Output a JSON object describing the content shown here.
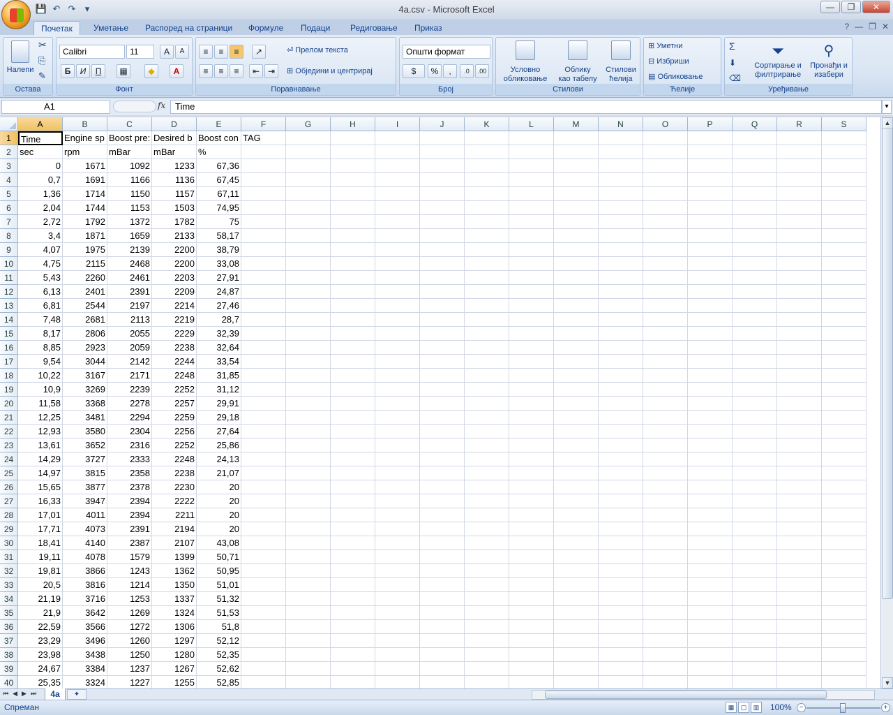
{
  "window": {
    "title": "4a.csv - Microsoft Excel"
  },
  "qat": {
    "save": "💾",
    "undo": "↶",
    "redo": "↷",
    "more": "▾"
  },
  "window_controls": {
    "minimize": "—",
    "restore": "❐",
    "close": "✕"
  },
  "tabs": [
    "Почетак",
    "Уметање",
    "Распоред на страници",
    "Формуле",
    "Подаци",
    "Редиговање",
    "Приказ"
  ],
  "ribbon": {
    "clipboard": {
      "label": "Остава",
      "paste": "Налепи"
    },
    "font": {
      "label": "Фонт",
      "font_name": "Calibri",
      "font_size": "11",
      "bold": "Б",
      "italic": "И",
      "underline": "П"
    },
    "alignment": {
      "label": "Поравнавање",
      "wrap": "Прелом текста",
      "merge": "Обједини и центрирај"
    },
    "number": {
      "label": "Број",
      "format": "Општи формат",
      "percent": "%",
      "comma": ","
    },
    "styles": {
      "label": "Стилови",
      "cond1": "Условно",
      "cond2": "обликовање",
      "table1": "Облику",
      "table2": "као табелу",
      "cell1": "Стилови",
      "cell2": "ћелија"
    },
    "cells": {
      "label": "Ћелије",
      "insert": "Уметни",
      "delete": "Избриши",
      "format": "Обликовање"
    },
    "editing": {
      "label": "Уређивање",
      "sort1": "Сортирање и",
      "sort2": "филтрирање",
      "find1": "Пронађи и",
      "find2": "изабери",
      "sigma": "Σ"
    }
  },
  "formula_bar": {
    "name_box": "A1",
    "fx": "fx",
    "content": "Time"
  },
  "columns": [
    "A",
    "B",
    "C",
    "D",
    "E",
    "F",
    "G",
    "H",
    "I",
    "J",
    "K",
    "L",
    "M",
    "N",
    "O",
    "P",
    "Q",
    "R",
    "S"
  ],
  "rows": [
    [
      "Time",
      "Engine sp",
      "Boost pre:",
      "Desired b",
      "Boost con",
      "TAG"
    ],
    [
      "sec",
      "rpm",
      "mBar",
      "mBar",
      "%",
      ""
    ],
    [
      "0",
      "1671",
      "1092",
      "1233",
      "67,36",
      ""
    ],
    [
      "0,7",
      "1691",
      "1166",
      "1136",
      "67,45",
      ""
    ],
    [
      "1,36",
      "1714",
      "1150",
      "1157",
      "67,11",
      ""
    ],
    [
      "2,04",
      "1744",
      "1153",
      "1503",
      "74,95",
      ""
    ],
    [
      "2,72",
      "1792",
      "1372",
      "1782",
      "75",
      ""
    ],
    [
      "3,4",
      "1871",
      "1659",
      "2133",
      "58,17",
      ""
    ],
    [
      "4,07",
      "1975",
      "2139",
      "2200",
      "38,79",
      ""
    ],
    [
      "4,75",
      "2115",
      "2468",
      "2200",
      "33,08",
      ""
    ],
    [
      "5,43",
      "2260",
      "2461",
      "2203",
      "27,91",
      ""
    ],
    [
      "6,13",
      "2401",
      "2391",
      "2209",
      "24,87",
      ""
    ],
    [
      "6,81",
      "2544",
      "2197",
      "2214",
      "27,46",
      ""
    ],
    [
      "7,48",
      "2681",
      "2113",
      "2219",
      "28,7",
      ""
    ],
    [
      "8,17",
      "2806",
      "2055",
      "2229",
      "32,39",
      ""
    ],
    [
      "8,85",
      "2923",
      "2059",
      "2238",
      "32,64",
      ""
    ],
    [
      "9,54",
      "3044",
      "2142",
      "2244",
      "33,54",
      ""
    ],
    [
      "10,22",
      "3167",
      "2171",
      "2248",
      "31,85",
      ""
    ],
    [
      "10,9",
      "3269",
      "2239",
      "2252",
      "31,12",
      ""
    ],
    [
      "11,58",
      "3368",
      "2278",
      "2257",
      "29,91",
      ""
    ],
    [
      "12,25",
      "3481",
      "2294",
      "2259",
      "29,18",
      ""
    ],
    [
      "12,93",
      "3580",
      "2304",
      "2256",
      "27,64",
      ""
    ],
    [
      "13,61",
      "3652",
      "2316",
      "2252",
      "25,86",
      ""
    ],
    [
      "14,29",
      "3727",
      "2333",
      "2248",
      "24,13",
      ""
    ],
    [
      "14,97",
      "3815",
      "2358",
      "2238",
      "21,07",
      ""
    ],
    [
      "15,65",
      "3877",
      "2378",
      "2230",
      "20",
      ""
    ],
    [
      "16,33",
      "3947",
      "2394",
      "2222",
      "20",
      ""
    ],
    [
      "17,01",
      "4011",
      "2394",
      "2211",
      "20",
      ""
    ],
    [
      "17,71",
      "4073",
      "2391",
      "2194",
      "20",
      ""
    ],
    [
      "18,41",
      "4140",
      "2387",
      "2107",
      "43,08",
      ""
    ],
    [
      "19,11",
      "4078",
      "1579",
      "1399",
      "50,71",
      ""
    ],
    [
      "19,81",
      "3866",
      "1243",
      "1362",
      "50,95",
      ""
    ],
    [
      "20,5",
      "3816",
      "1214",
      "1350",
      "51,01",
      ""
    ],
    [
      "21,19",
      "3716",
      "1253",
      "1337",
      "51,32",
      ""
    ],
    [
      "21,9",
      "3642",
      "1269",
      "1324",
      "51,53",
      ""
    ],
    [
      "22,59",
      "3566",
      "1272",
      "1306",
      "51,8",
      ""
    ],
    [
      "23,29",
      "3496",
      "1260",
      "1297",
      "52,12",
      ""
    ],
    [
      "23,98",
      "3438",
      "1250",
      "1280",
      "52,35",
      ""
    ],
    [
      "24,67",
      "3384",
      "1237",
      "1267",
      "52,62",
      ""
    ],
    [
      "25,35",
      "3324",
      "1227",
      "1255",
      "52,85",
      ""
    ]
  ],
  "sheet_tab": "4a",
  "status": {
    "ready": "Спреман",
    "zoom": "100%"
  }
}
